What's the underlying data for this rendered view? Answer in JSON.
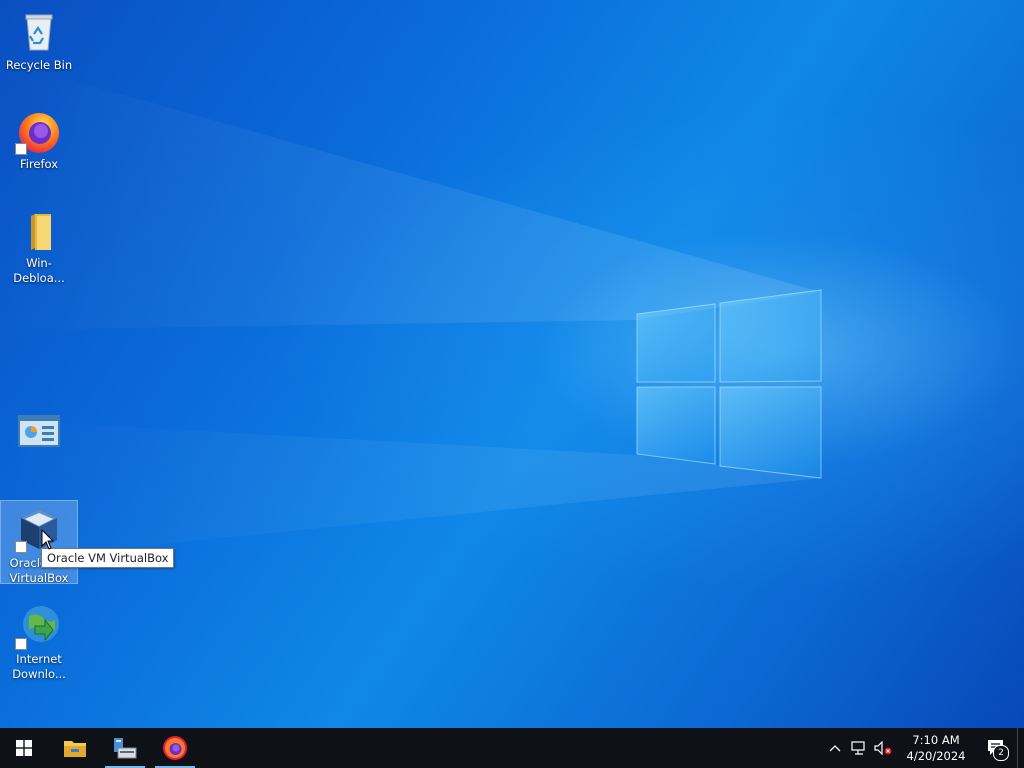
{
  "desktop": {
    "icons": [
      {
        "label": "Recycle Bin",
        "icon": "recycle-bin-icon"
      },
      {
        "label": "Firefox",
        "icon": "firefox-icon"
      },
      {
        "label": "Win-Debloa...",
        "icon": "folder-icon"
      },
      {
        "label": "",
        "icon": "control-panel-icon"
      },
      {
        "label": "Oracle VM VirtualBox",
        "icon": "virtualbox-icon"
      },
      {
        "label": "Internet Downlo...",
        "icon": "internet-download-manager-icon"
      }
    ],
    "tooltip": "Oracle VM VirtualBox"
  },
  "taskbar": {
    "buttons": [
      {
        "name": "start-button",
        "icon": "windows-logo-icon"
      },
      {
        "name": "file-explorer",
        "icon": "folder-icon"
      },
      {
        "name": "server-manager",
        "icon": "server-manager-icon"
      },
      {
        "name": "firefox",
        "icon": "firefox-icon"
      }
    ],
    "tray": {
      "time": "7:10 AM",
      "date": "4/20/2024",
      "notification_count": "2"
    }
  },
  "colors": {
    "taskbar": "#0e1116",
    "accent_underline": "#76b9ed",
    "desktop_blue": "#0a6bd9"
  }
}
